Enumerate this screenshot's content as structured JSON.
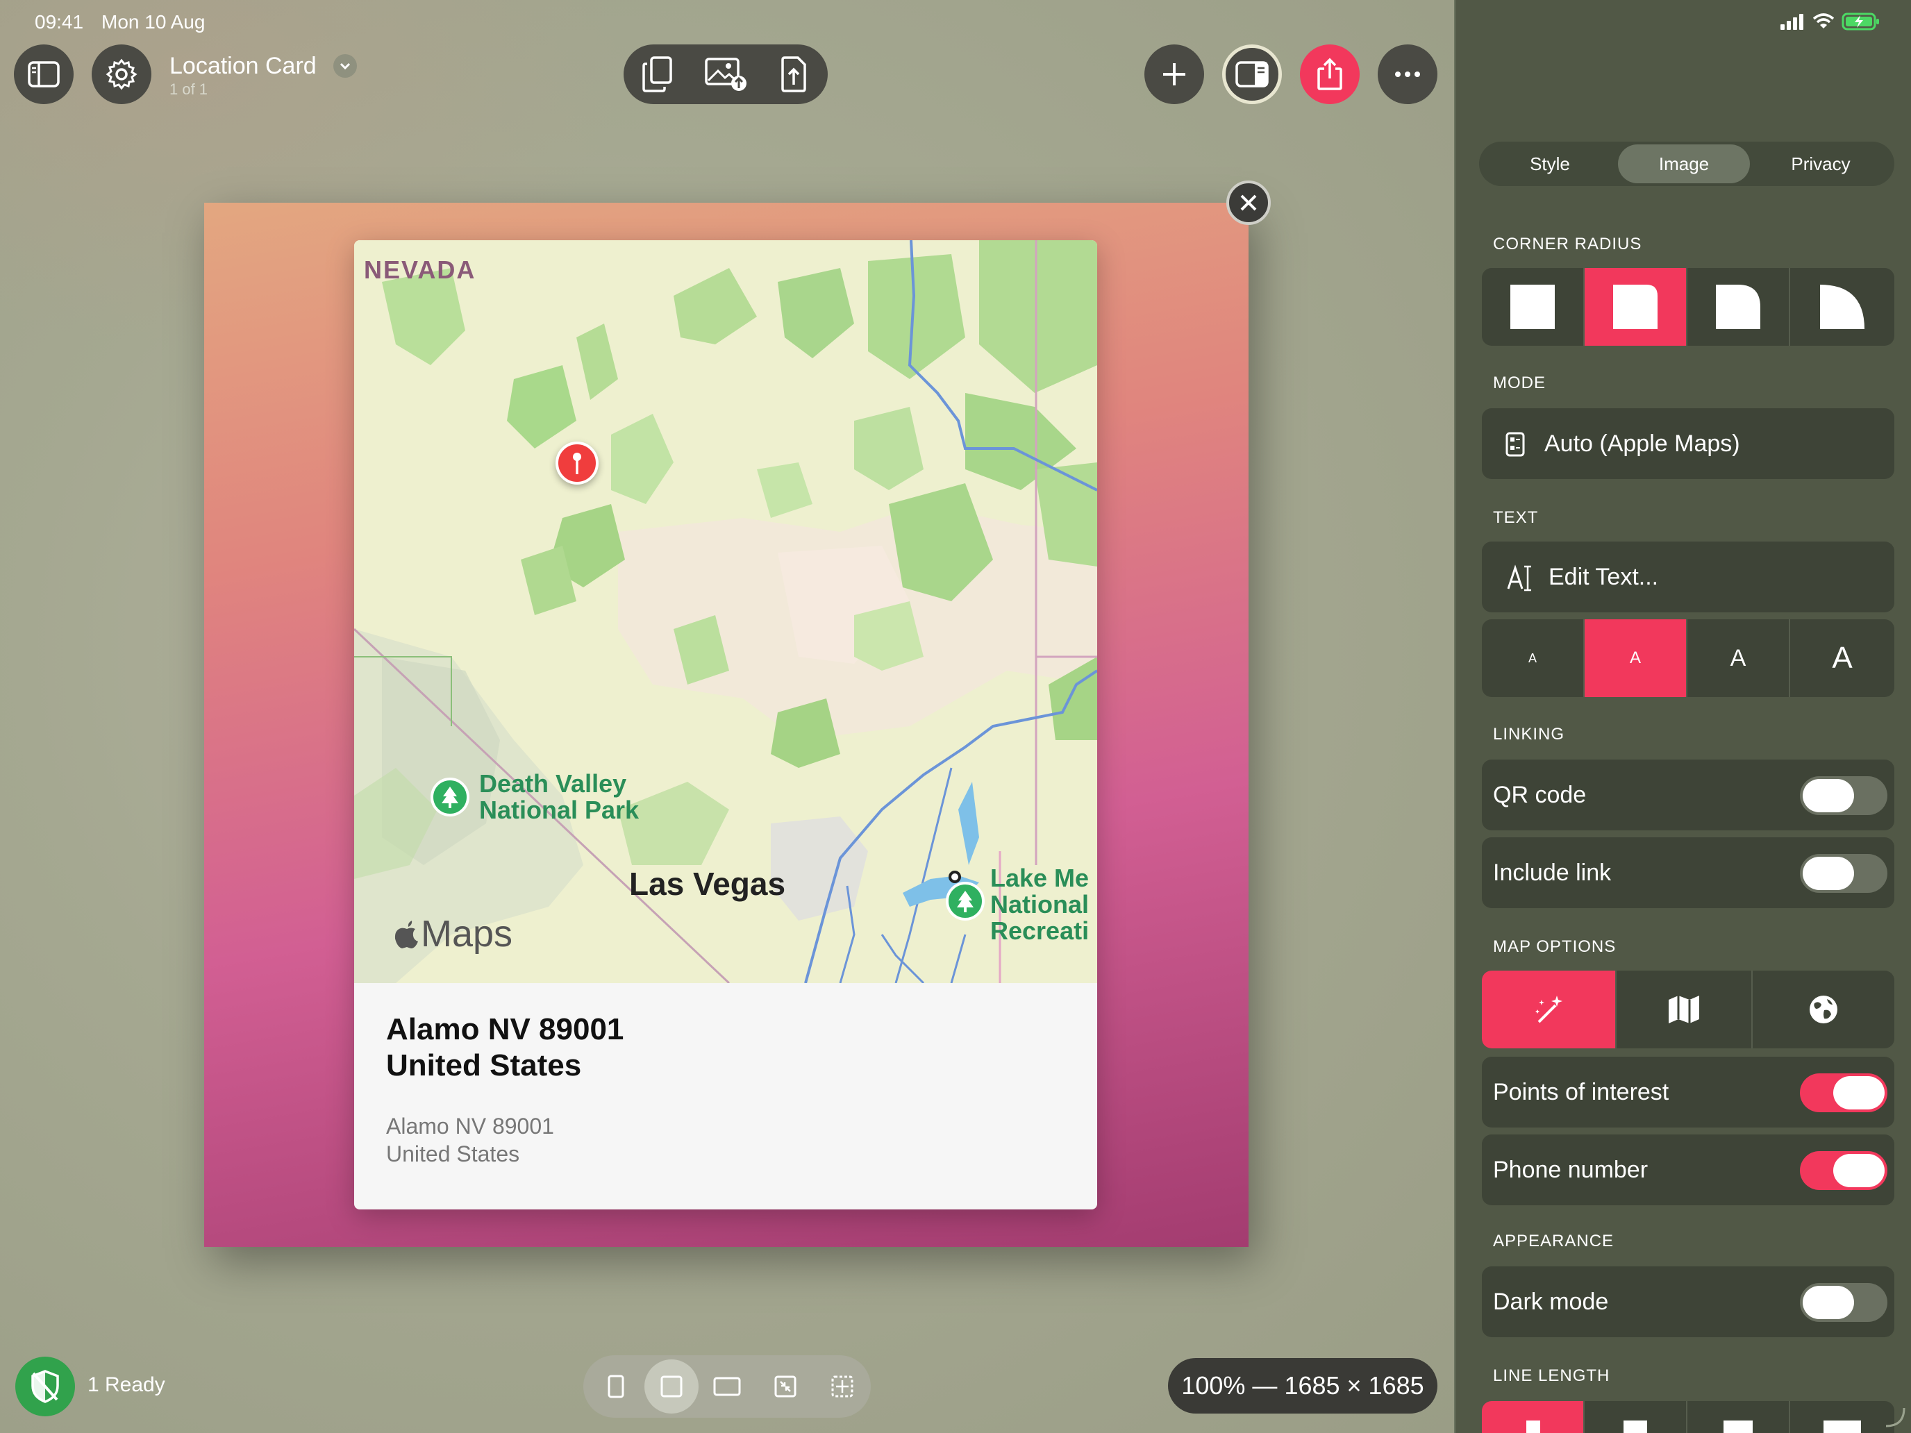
{
  "status_bar": {
    "time": "09:41",
    "date": "Mon 10 Aug"
  },
  "toolbar": {
    "title": "Location Card",
    "subtitle": "1 of 1"
  },
  "card": {
    "map_labels": {
      "state": "NEVADA",
      "park1_line1": "Death Valley",
      "park1_line2": "National Park",
      "city": "Las Vegas",
      "lake_line1": "Lake Me",
      "lake_line2": "National",
      "lake_line3": "Recreati",
      "brand": "Maps"
    },
    "address_title_line1": "Alamo NV 89001",
    "address_title_line2": "United States",
    "address_sub_line1": "Alamo NV 89001",
    "address_sub_line2": "United States"
  },
  "bottom_bar": {
    "ready_label": "1 Ready",
    "zoom_readout": "100% — 1685 × 1685"
  },
  "inspector": {
    "tabs": [
      "Style",
      "Image",
      "Privacy"
    ],
    "active_tab": "Image",
    "corner_radius_label": "CORNER RADIUS",
    "mode_label": "MODE",
    "mode_value": "Auto (Apple Maps)",
    "text_label": "TEXT",
    "edit_text": "Edit Text...",
    "text_size_glyph": "A",
    "linking_label": "LINKING",
    "qr_code": {
      "label": "QR code",
      "on": false
    },
    "include_link": {
      "label": "Include link",
      "on": false
    },
    "map_options_label": "MAP OPTIONS",
    "points_of_interest": {
      "label": "Points of interest",
      "on": true
    },
    "phone_number": {
      "label": "Phone number",
      "on": true
    },
    "appearance_label": "APPEARANCE",
    "dark_mode": {
      "label": "Dark mode",
      "on": false
    },
    "line_length_label": "LINE LENGTH"
  },
  "colors": {
    "accent": "#f2385c",
    "panel_bg": "#515846",
    "panel_cell": "#3e4437",
    "ready_green": "#31a24c"
  }
}
